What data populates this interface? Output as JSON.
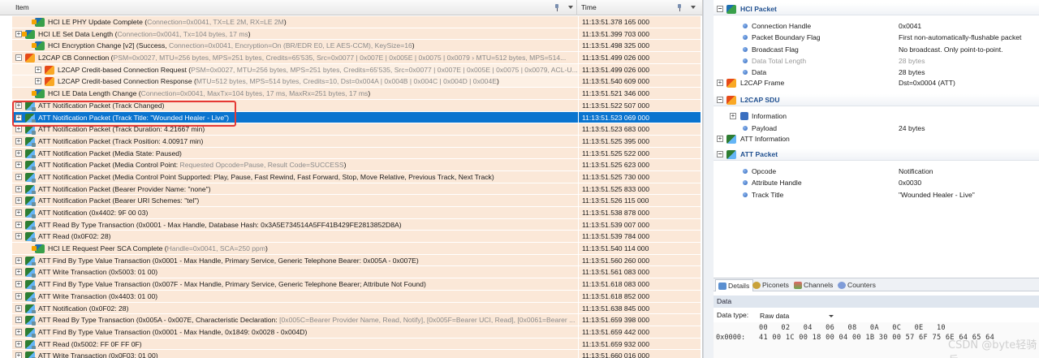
{
  "columns": {
    "item": "Item",
    "time": "Time"
  },
  "rows": [
    {
      "indent": 1,
      "icon": "hci",
      "expander": "",
      "main": "HCI LE PHY Update Complete (",
      "params": "Connection=0x0041, TX=LE 2M, RX=LE 2M",
      "tail": ")",
      "time": "11:13:51.378 165 000"
    },
    {
      "indent": 0,
      "icon": "hci",
      "expander": "+",
      "main": "HCI LE Set Data Length (",
      "params": "Connection=0x0041, Tx=104 bytes, 17 ms",
      "tail": ")",
      "time": "11:13:51.399 703 000"
    },
    {
      "indent": 1,
      "icon": "hci",
      "expander": "",
      "main": "HCI Encryption Change [v2] (Success, ",
      "params": "Connection=0x0041, Encryption=On (BR/EDR E0, LE AES-CCM), KeySize=16",
      "tail": ")",
      "time": "11:13:51.498 325 000"
    },
    {
      "indent": 0,
      "icon": "l2cap",
      "expander": "−",
      "main": "L2CAP CB Connection (",
      "params": "PSM=0x0027, MTU=256 bytes, MPS=251 bytes, Credits=65'535, Src=0x0077 | 0x007E | 0x005E | 0x0075 | 0x0079 › MTU=512 bytes, MPS=514...",
      "tail": "",
      "time": "11:13:51.499 026 000"
    },
    {
      "indent": 2,
      "icon": "l2cap",
      "expander": "+",
      "main": "L2CAP Credit-based Connection Request (",
      "params": "PSM=0x0027, MTU=256 bytes, MPS=251 bytes, Credits=65'535, Src=0x0077 | 0x007E | 0x005E | 0x0075 | 0x0079, ACL-U...",
      "tail": "",
      "time": "11:13:51.499 026 000",
      "plain": true
    },
    {
      "indent": 2,
      "icon": "l2cap",
      "expander": "+",
      "main": "L2CAP Credit-based Connection Response (",
      "params": "MTU=512 bytes, MPS=514 bytes, Credits=10, Dst=0x004A | 0x004B | 0x004C | 0x004D | 0x004E",
      "tail": ")",
      "time": "11:13:51.540 609 000",
      "plain": true
    },
    {
      "indent": 1,
      "icon": "hci",
      "expander": "",
      "main": "HCI LE Data Length Change (",
      "params": "Connection=0x0041, MaxTx=104 bytes, 17 ms, MaxRx=251 bytes, 17 ms",
      "tail": ")",
      "time": "11:13:51.521 346 000"
    },
    {
      "indent": 0,
      "icon": "att",
      "expander": "+",
      "main": "ATT Notification Packet (Track Changed)",
      "params": "",
      "tail": "",
      "time": "11:13:51.522 507 000"
    },
    {
      "indent": 0,
      "icon": "att",
      "expander": "+",
      "main": "ATT Notification Packet (Track Title: \"Wounded Healer - Live\")",
      "params": "",
      "tail": "",
      "time": "11:13:51.523 069 000",
      "selected": true
    },
    {
      "indent": 0,
      "icon": "att",
      "expander": "+",
      "main": "ATT Notification Packet (Track Duration: 4.21667 min)",
      "params": "",
      "tail": "",
      "time": "11:13:51.523 683 000"
    },
    {
      "indent": 0,
      "icon": "att",
      "expander": "+",
      "main": "ATT Notification Packet (Track Position: 4.00917 min)",
      "params": "",
      "tail": "",
      "time": "11:13:51.525 395 000"
    },
    {
      "indent": 0,
      "icon": "att",
      "expander": "+",
      "main": "ATT Notification Packet (Media State: Paused)",
      "params": "",
      "tail": "",
      "time": "11:13:51.525 522 000"
    },
    {
      "indent": 0,
      "icon": "att",
      "expander": "+",
      "main": "ATT Notification Packet (Media Control Point: ",
      "params": "Requested Opcode=Pause, Result Code=SUCCESS",
      "tail": ")",
      "time": "11:13:51.525 623 000"
    },
    {
      "indent": 0,
      "icon": "att",
      "expander": "+",
      "main": "ATT Notification Packet (Media Control Point Supported: Play, Pause, Fast Rewind, Fast Forward, Stop, Move Relative, Previous Track, Next Track)",
      "params": "",
      "tail": "",
      "time": "11:13:51.525 730 000"
    },
    {
      "indent": 0,
      "icon": "att",
      "expander": "+",
      "main": "ATT Notification Packet (Bearer Provider Name: \"none\")",
      "params": "",
      "tail": "",
      "time": "11:13:51.525 833 000"
    },
    {
      "indent": 0,
      "icon": "att",
      "expander": "+",
      "main": "ATT Notification Packet (Bearer URI Schemes: \"tel\")",
      "params": "",
      "tail": "",
      "time": "11:13:51.526 115 000"
    },
    {
      "indent": 0,
      "icon": "att",
      "expander": "+",
      "main": "ATT Notification (0x4402: 9F 00 03)",
      "params": "",
      "tail": "",
      "time": "11:13:51.538 878 000"
    },
    {
      "indent": 0,
      "icon": "att",
      "expander": "+",
      "main": "ATT Read By Type Transaction (0x0001 - Max Handle, Database Hash: 0x3A5E734514A5FF41B429FE2813852D8A)",
      "params": "",
      "tail": "",
      "time": "11:13:51.539 007 000"
    },
    {
      "indent": 0,
      "icon": "att",
      "expander": "+",
      "main": "ATT Read (0x0F02: 28)",
      "params": "",
      "tail": "",
      "time": "11:13:51.539 784 000"
    },
    {
      "indent": 1,
      "icon": "hci",
      "expander": "",
      "main": "HCI LE Request Peer SCA Complete (",
      "params": "Handle=0x0041, SCA=250 ppm",
      "tail": ")",
      "time": "11:13:51.540 114 000"
    },
    {
      "indent": 0,
      "icon": "att",
      "expander": "+",
      "main": "ATT Find By Type Value Transaction (0x0001 - Max Handle, Primary Service, Generic Telephone Bearer: 0x005A - 0x007E)",
      "params": "",
      "tail": "",
      "time": "11:13:51.560 260 000"
    },
    {
      "indent": 0,
      "icon": "att",
      "expander": "+",
      "main": "ATT Write Transaction (0x5003: 01 00)",
      "params": "",
      "tail": "",
      "time": "11:13:51.561 083 000"
    },
    {
      "indent": 0,
      "icon": "att",
      "expander": "+",
      "main": "ATT Find By Type Value Transaction (0x007F - Max Handle, Primary Service, Generic Telephone Bearer; Attribute Not Found)",
      "params": "",
      "tail": "",
      "time": "11:13:51.618 083 000"
    },
    {
      "indent": 0,
      "icon": "att",
      "expander": "+",
      "main": "ATT Write Transaction (0x4403: 01 00)",
      "params": "",
      "tail": "",
      "time": "11:13:51.618 852 000"
    },
    {
      "indent": 0,
      "icon": "att",
      "expander": "+",
      "main": "ATT Notification (0x0F02: 28)",
      "params": "",
      "tail": "",
      "time": "11:13:51.638 845 000"
    },
    {
      "indent": 0,
      "icon": "att",
      "expander": "+",
      "main": "ATT Read By Type Transaction (0x005A - 0x007E, Characteristic Declaration: ",
      "params": "[0x005C=Bearer Provider Name, Read, Notify], [0x005F=Bearer UCI, Read], [0x0061=Bearer ...",
      "tail": "",
      "time": "11:13:51.659 398 000"
    },
    {
      "indent": 0,
      "icon": "att",
      "expander": "+",
      "main": "ATT Find By Type Value Transaction (0x0001 - Max Handle, 0x1849: 0x0028 - 0x004D)",
      "params": "",
      "tail": "",
      "time": "11:13:51.659 442 000"
    },
    {
      "indent": 0,
      "icon": "att",
      "expander": "+",
      "main": "ATT Read (0x5002: FF 0F FF 0F)",
      "params": "",
      "tail": "",
      "time": "11:13:51.659 932 000"
    },
    {
      "indent": 0,
      "icon": "att",
      "expander": "+",
      "main": "ATT Write Transaction (0x0F03: 01 00)",
      "params": "",
      "tail": "",
      "time": "11:13:51.660 016 000"
    }
  ],
  "details": {
    "hci_packet": {
      "title": "HCI Packet",
      "fields": [
        {
          "name": "Connection Handle",
          "value": "0x0041",
          "gray": false
        },
        {
          "name": "Packet Boundary Flag",
          "value": "First non-automatically-flushable packet",
          "gray": false
        },
        {
          "name": "Broadcast Flag",
          "value": "No broadcast. Only point-to-point.",
          "gray": false
        },
        {
          "name": "Data Total Length",
          "value": "28 bytes",
          "gray": true
        },
        {
          "name": "Data",
          "value": "28 bytes",
          "gray": false
        }
      ]
    },
    "l2cap_frame": {
      "name": "L2CAP Frame",
      "value": "Dst=0x0004 (ATT)"
    },
    "l2cap_sdu": {
      "title": "L2CAP SDU",
      "fields": [
        {
          "name": "Information",
          "value": ""
        },
        {
          "name": "Payload",
          "value": "24 bytes"
        }
      ]
    },
    "att_information": "ATT Information",
    "att_packet": {
      "title": "ATT Packet",
      "fields": [
        {
          "name": "Opcode",
          "value": "Notification"
        },
        {
          "name": "Attribute Handle",
          "value": "0x0030"
        },
        {
          "name": "Track Title",
          "value": "\"Wounded Healer - Live\""
        }
      ]
    }
  },
  "tabs": [
    "Details",
    "Piconets",
    "Channels",
    "Counters"
  ],
  "data_panel": {
    "title": "Data",
    "type_label": "Data type:",
    "type_value": "Raw data",
    "hex_columns": "00   02   04   06   08   0A   0C   0E   10",
    "hex_address": "0x0000:",
    "hex_bytes": "41 00 1C 00 18 00 04 00 1B 30 00 57 6F 75 6E 64 65 64"
  },
  "watermark": "CSDN @byte轻骑兵"
}
